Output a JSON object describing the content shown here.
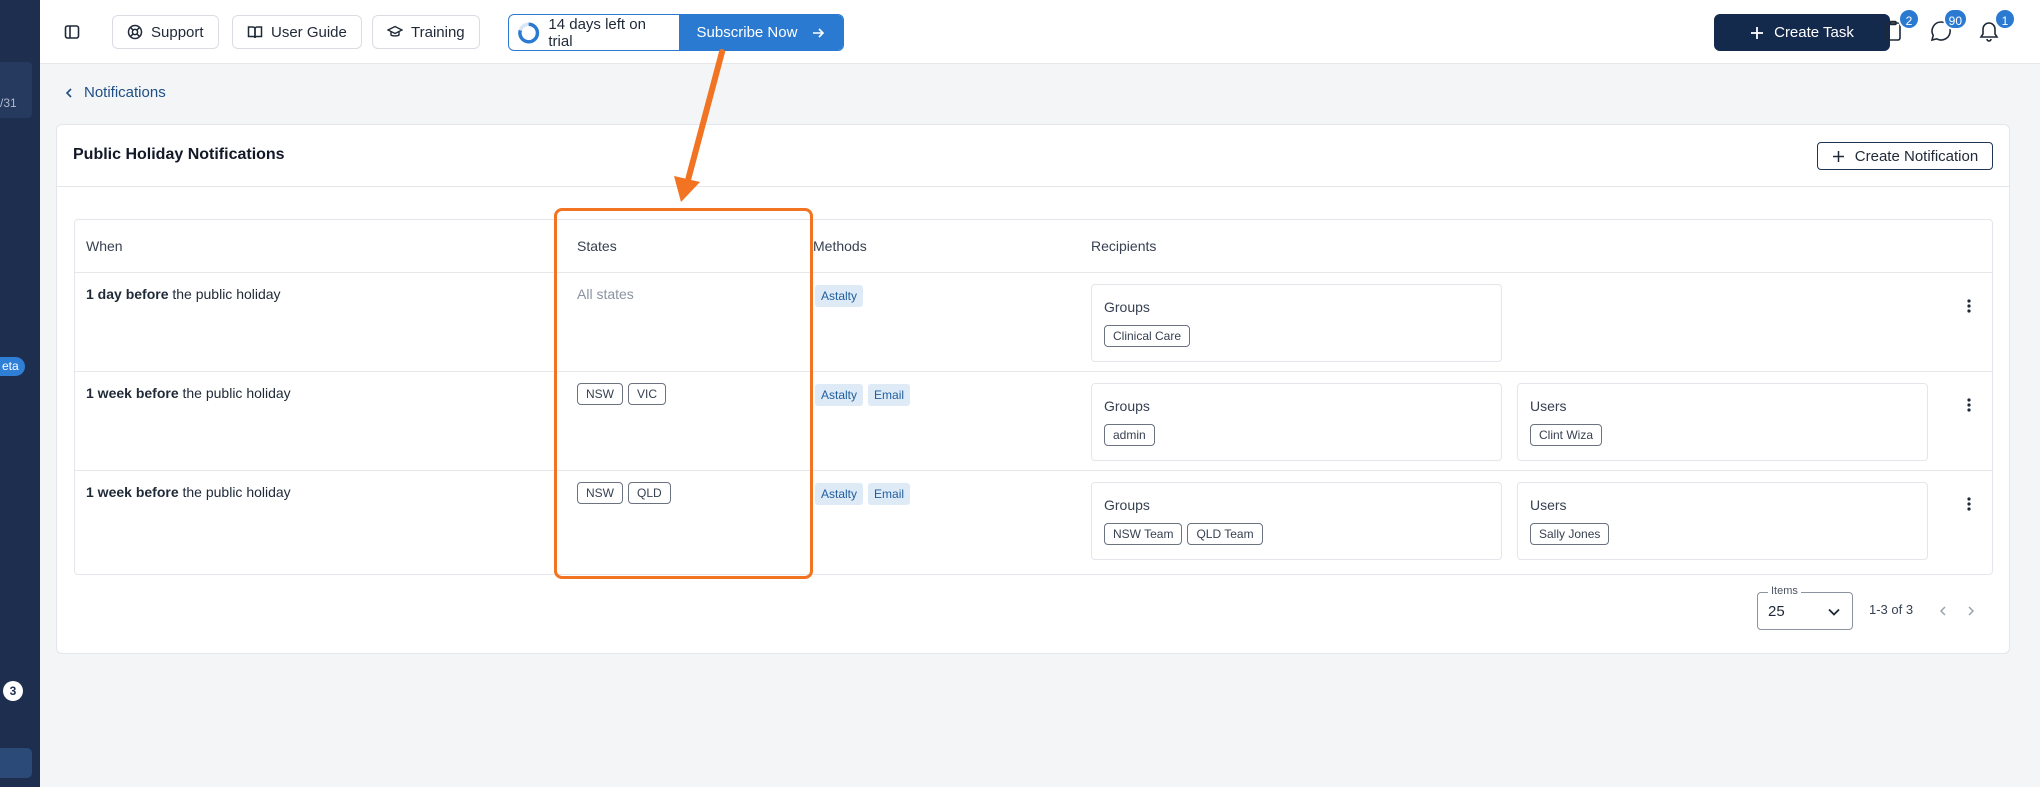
{
  "sidebar": {
    "date_fragment": "/31",
    "beta_label": "eta",
    "count_badge": "3"
  },
  "header": {
    "support_label": "Support",
    "user_guide_label": "User Guide",
    "training_label": "Training",
    "trial_text": "14 days left on trial",
    "subscribe_label": "Subscribe Now",
    "create_task_label": "Create Task",
    "tasks_badge": "2",
    "messages_badge": "90",
    "notifications_badge": "1"
  },
  "breadcrumb": {
    "label": "Notifications"
  },
  "card": {
    "title": "Public Holiday Notifications",
    "create_label": "Create Notification"
  },
  "table": {
    "headers": {
      "when": "When",
      "states": "States",
      "methods": "Methods",
      "recipients": "Recipients"
    },
    "rows": [
      {
        "when_bold": "1 day before",
        "when_rest": " the public holiday",
        "states_text": "All states",
        "states": [],
        "methods": [
          "Astalty"
        ],
        "groups_label": "Groups",
        "groups": [
          "Clinical Care"
        ],
        "users_label": "",
        "users": []
      },
      {
        "when_bold": "1 week before",
        "when_rest": " the public holiday",
        "states_text": "",
        "states": [
          "NSW",
          "VIC"
        ],
        "methods": [
          "Astalty",
          "Email"
        ],
        "groups_label": "Groups",
        "groups": [
          "admin"
        ],
        "users_label": "Users",
        "users": [
          "Clint Wiza"
        ]
      },
      {
        "when_bold": "1 week before",
        "when_rest": " the public holiday",
        "states_text": "",
        "states": [
          "NSW",
          "QLD"
        ],
        "methods": [
          "Astalty",
          "Email"
        ],
        "groups_label": "Groups",
        "groups": [
          "NSW Team",
          "QLD Team"
        ],
        "users_label": "Users",
        "users": [
          "Sally Jones"
        ]
      }
    ]
  },
  "pagination": {
    "items_label": "Items",
    "items_value": "25",
    "range": "1-3 of 3"
  },
  "colors": {
    "primary": "#2a7ad1",
    "dark_navy": "#142a4d",
    "annotation_orange": "#f27322"
  }
}
